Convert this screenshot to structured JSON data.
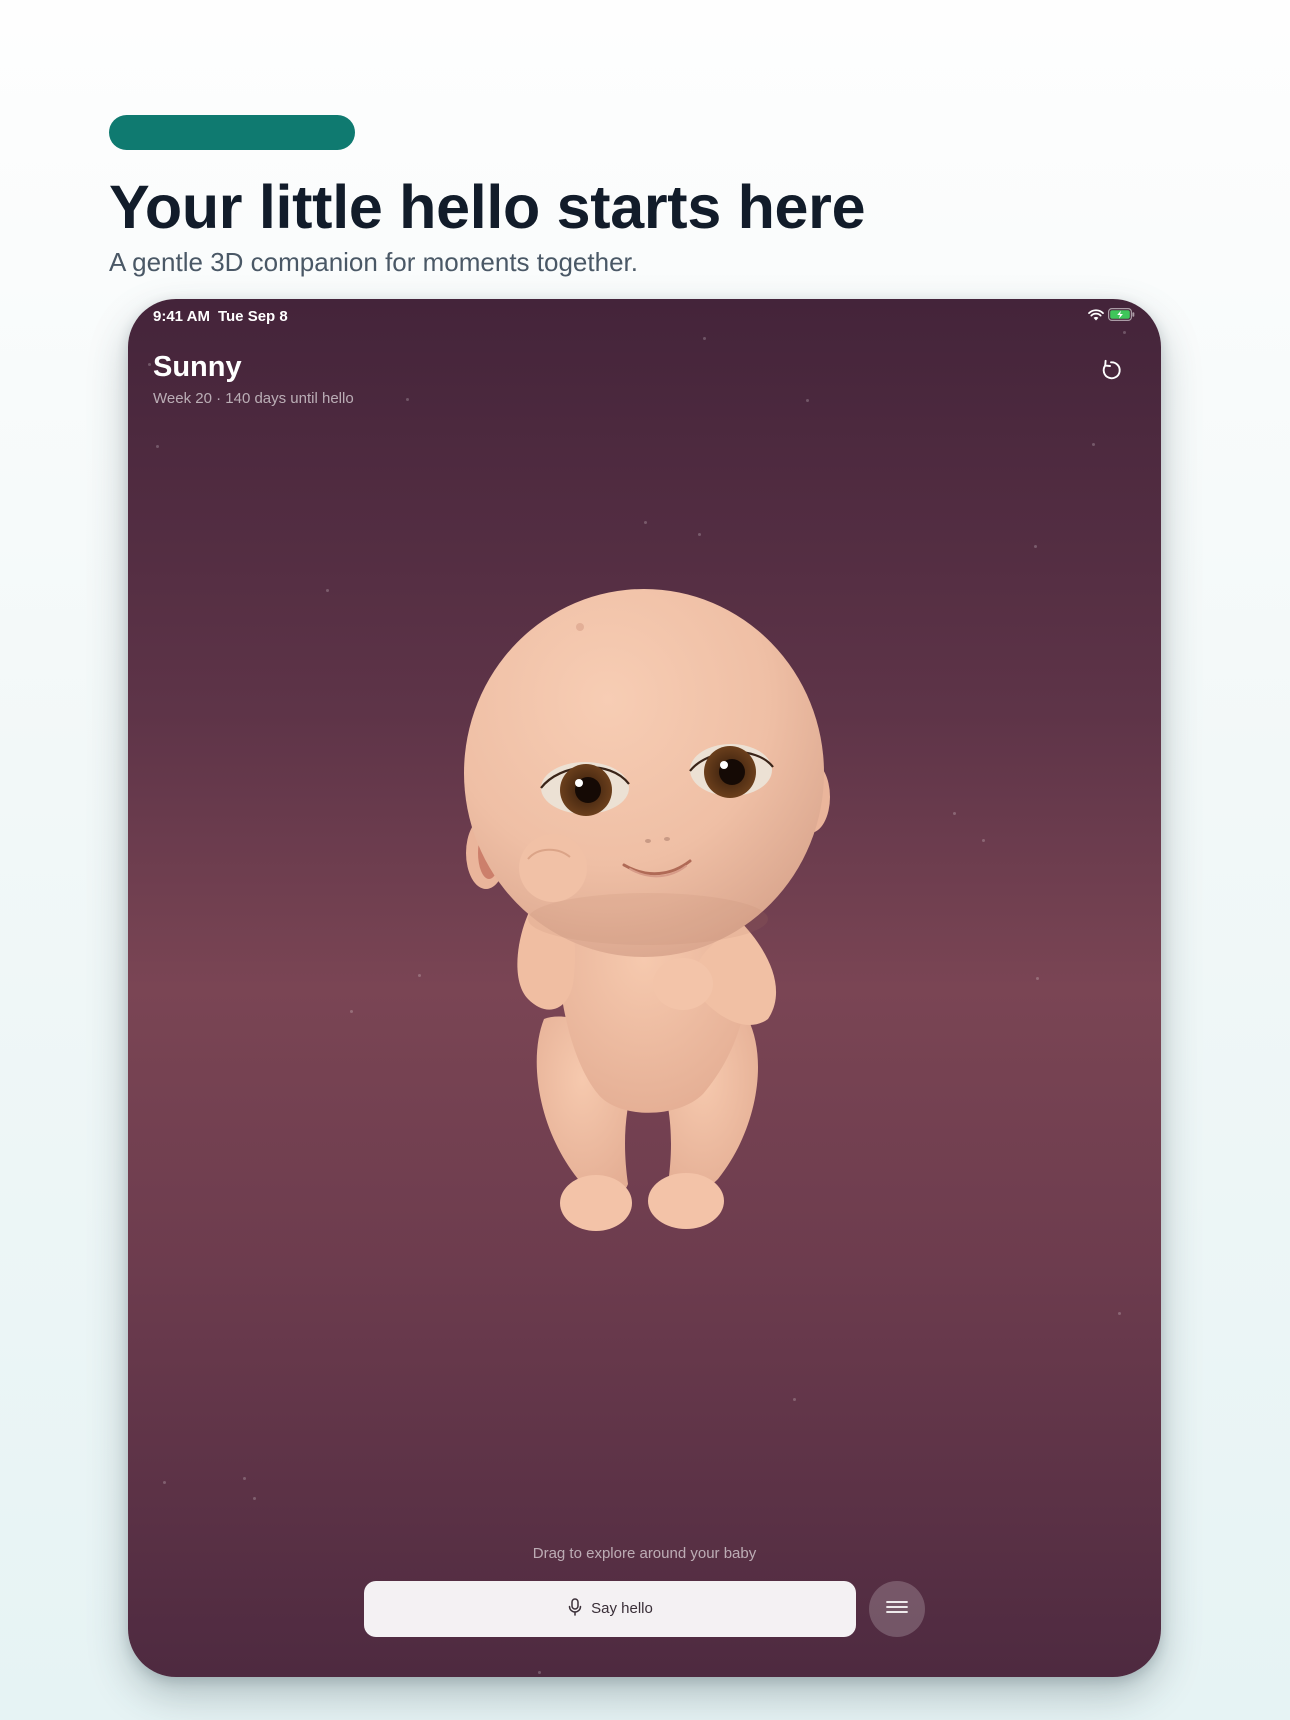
{
  "hero": {
    "headline": "Your little hello starts here",
    "subheadline": "A gentle 3D companion for moments together."
  },
  "status_bar": {
    "time": "9:41 AM",
    "date": "Tue Sep 8"
  },
  "baby": {
    "name": "Sunny",
    "countdown": "Week 20 · 140 days until hello"
  },
  "controls": {
    "hint": "Drag to explore around your baby",
    "say_hello_label": "Say hello"
  },
  "icons": {
    "reset": "reset-icon",
    "microphone": "microphone-icon",
    "menu": "menu-icon",
    "wifi": "wifi-icon",
    "battery": "battery-charging-icon"
  },
  "colors": {
    "accent": "#0f7a70",
    "headline": "#121c2a",
    "scene_top": "#44243a",
    "scene_mid": "#7a4554",
    "skin": "#f2c4ab",
    "button_bg": "#f4f1f3",
    "battery_fill": "#3fc65a"
  }
}
